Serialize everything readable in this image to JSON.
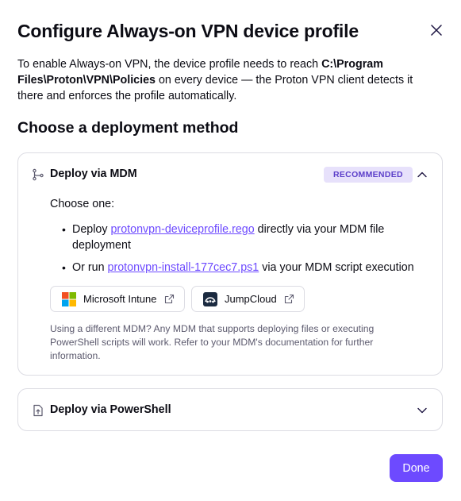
{
  "dialog": {
    "title": "Configure Always-on VPN device profile",
    "intro": {
      "part1": "To enable Always-on VPN, the device profile needs to reach ",
      "path": "C:\\Program Files\\Proton\\VPN\\Policies",
      "part2": " on every device — the Proton VPN client detects it there and enforces the profile automatically."
    },
    "section_title": "Choose a deployment method",
    "done_label": "Done"
  },
  "mdm_card": {
    "label": "Deploy via MDM",
    "badge": "RECOMMENDED",
    "choose": "Choose one:",
    "bullet1": {
      "prefix": "Deploy ",
      "link": "protonvpn-deviceprofile.rego",
      "suffix": " directly via your MDM file deployment"
    },
    "bullet2": {
      "prefix": "Or run ",
      "link": "protonvpn-install-177cec7.ps1",
      "suffix": " via your MDM script execution"
    },
    "providers": [
      {
        "label": "Microsoft Intune",
        "icon": "microsoft-logo"
      },
      {
        "label": "JumpCloud",
        "icon": "jumpcloud-logo"
      }
    ],
    "note": "Using a different MDM? Any MDM that supports deploying files or executing PowerShell scripts will work. Refer to your MDM's documentation for further information."
  },
  "ps_card": {
    "label": "Deploy via PowerShell"
  },
  "colors": {
    "accent": "#6d4aff",
    "badge_bg": "#e7e1fb",
    "badge_text": "#5b3ec9",
    "border": "#dcdce3"
  }
}
